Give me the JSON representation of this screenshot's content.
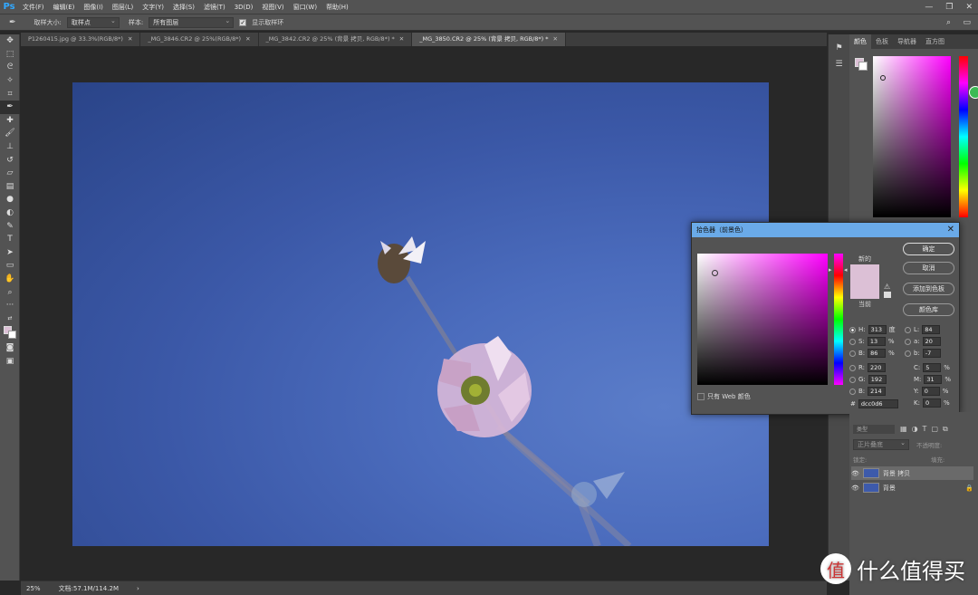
{
  "app": {
    "logo": "Ps"
  },
  "menu": [
    "文件(F)",
    "编辑(E)",
    "图像(I)",
    "图层(L)",
    "文字(Y)",
    "选择(S)",
    "滤镜(T)",
    "3D(D)",
    "视图(V)",
    "窗口(W)",
    "帮助(H)"
  ],
  "options": {
    "sample_size_label": "取样大小:",
    "sample_size_value": "取样点",
    "sample_label": "样本:",
    "sample_value": "所有图层",
    "show_ring_label": "显示取样环"
  },
  "tabs": [
    {
      "label": "P1260415.jpg @ 33.3%(RGB/8*)"
    },
    {
      "label": "_MG_3846.CR2 @ 25%(RGB/8*)"
    },
    {
      "label": "_MG_3842.CR2 @ 25% (背景 拷贝, RGB/8*) *"
    },
    {
      "label": "_MG_3850.CR2 @ 25% (背景 拷贝, RGB/8*) *",
      "active": true
    }
  ],
  "status": {
    "zoom": "25%",
    "doc": "文档:57.1M/114.2M"
  },
  "right_panel": {
    "tabs": [
      "颜色",
      "色板",
      "导航器",
      "直方图"
    ]
  },
  "picker": {
    "title": "拾色器（前景色）",
    "new_label": "新的",
    "current_label": "当前",
    "buttons": {
      "ok": "确定",
      "cancel": "取消",
      "add": "添加到色板",
      "library": "颜色库"
    },
    "hsb": {
      "h": "313",
      "h_unit": "度",
      "s": "13",
      "b": "86",
      "pct": "%"
    },
    "rgb": {
      "r": "220",
      "g": "192",
      "b": "214"
    },
    "lab": {
      "l": "84",
      "a": "20",
      "b": "-7"
    },
    "cmyk": {
      "c": "5",
      "m": "31",
      "y": "0",
      "k": "0"
    },
    "hex": "dcc0d6",
    "web_only": "只有 Web 颜色",
    "colors": {
      "selected": "#dcc0d6"
    }
  },
  "layers": {
    "kind_label": "类型",
    "blend_mode": "正片叠底",
    "opacity_label": "不透明度:",
    "lock_label": "锁定:",
    "fill_label": "填充:",
    "items": [
      {
        "name": "背景 拷贝"
      },
      {
        "name": "背景"
      }
    ]
  },
  "watermark": {
    "text": "什么值得买",
    "icon": "值"
  }
}
